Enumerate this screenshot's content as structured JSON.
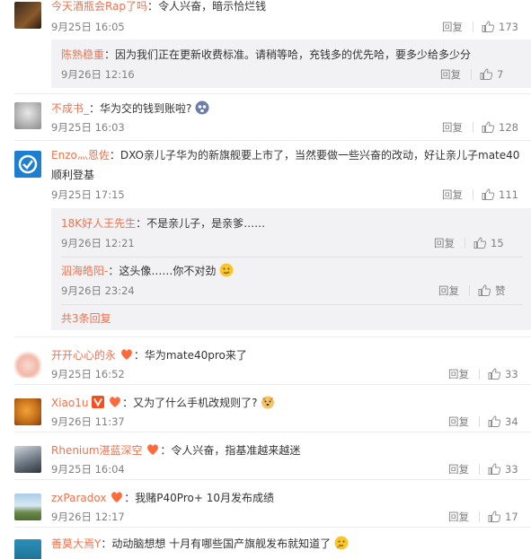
{
  "ui": {
    "reply_label": "回复",
    "more_label": "共3条回复"
  },
  "comments": [
    {
      "user": "今天酒瓶会Rap了吗",
      "text": "令人兴奋，暗示恰烂钱",
      "time": "9月25日 16:05",
      "likes": "173",
      "replies": [
        {
          "user": "陈熟稳重",
          "text": "因为我们正在更新收费标准。请稍等哈，充钱多的优先哈，要多少给多少分",
          "time": "9月26日 12:16",
          "likes": "7"
        }
      ]
    },
    {
      "user": "不成书_",
      "text": "华为交的钱到账啦?",
      "time": "9月25日 16:03",
      "likes": "128"
    },
    {
      "user": "Enzo灬恩佐",
      "text_line1": "DXO亲儿子华为的新旗舰要上市了，当然要做一些兴奋的改动，好让亲儿子mate40",
      "text_line2": "顺利登基",
      "time": "9月25日 17:15",
      "likes": "111",
      "replies": [
        {
          "user": "18K好人王先生",
          "text": "不是亲儿子，是亲爹……",
          "time": "9月26日 12:21",
          "likes": "15"
        },
        {
          "user": "泅海皓阳-",
          "text": "这头像……你不对劲",
          "time": "9月26日 23:24",
          "likes": "赞"
        }
      ]
    },
    {
      "user": "开开心心的永",
      "text": "华为mate40pro来了",
      "time": "9月25日 16:52",
      "likes": "33"
    },
    {
      "user": "Xiao1u",
      "text": "又为了什么手机改规则了?",
      "time": "9月26日 11:37",
      "likes": "34"
    },
    {
      "user": "Rhenium湛蓝深空",
      "text": "令人兴奋，指基准越来越迷",
      "time": "9月25日 16:04",
      "likes": "33"
    },
    {
      "user": "zxParadox",
      "text": "我赌P40Pro+ 10月发布成绩",
      "time": "9月26日 12:17",
      "likes": "17"
    },
    {
      "user": "善莫大焉Y",
      "text": "动动脑想想  十月有哪些国产旗舰发布就知道了",
      "time": "",
      "likes": ""
    }
  ]
}
